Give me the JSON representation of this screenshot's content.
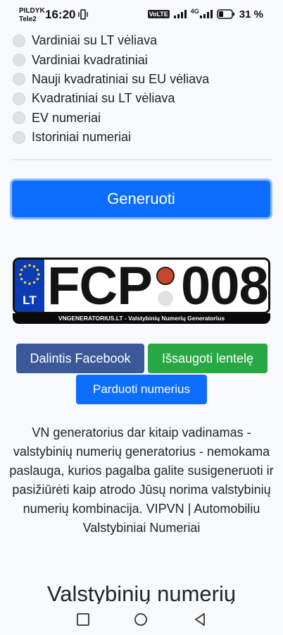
{
  "status": {
    "carrier_top": "PILDYK",
    "carrier_bottom": "Tele2",
    "time": "16:20",
    "volte": "VoLTE",
    "network": "4G",
    "battery": "31 %"
  },
  "plate_types": [
    {
      "label": "Vardiniai su LT vėliava",
      "checked": false
    },
    {
      "label": "Vardiniai kvadratiniai",
      "checked": false
    },
    {
      "label": "Nauji kvadratiniai su EU vėliava",
      "checked": false
    },
    {
      "label": "Kvadratiniai su LT vėliava",
      "checked": false
    },
    {
      "label": "EV numeriai",
      "checked": false
    },
    {
      "label": "Istoriniai numeriai",
      "checked": false
    }
  ],
  "generate_label": "Generuoti",
  "plate": {
    "country": "LT",
    "left_text": "FCP",
    "right_text": "008",
    "footer": "VNGENERATORIUS.LT - Valstybinių Numerių Generatorius"
  },
  "actions": {
    "facebook_label": "Dalintis Facebook",
    "save_label": "Išsaugoti lentelę",
    "sell_label": "Parduoti numerius"
  },
  "description": "VN generatorius dar kitaip vadinamas - valstybinių numerių generatorius - nemokama paslauga, kurios pagalba galite susigeneruoti ir pasižiūrėti kaip atrodo Jūsų norima valstybinių numerių kombinacija. VIPVN | Automobiliu Valstybiniai Numeriai",
  "section_heading": "Valstybinių numerių",
  "colors": {
    "primary": "#0d6efd",
    "facebook": "#3b5998",
    "success": "#28a745",
    "eu_band": "#0b3bb5"
  }
}
